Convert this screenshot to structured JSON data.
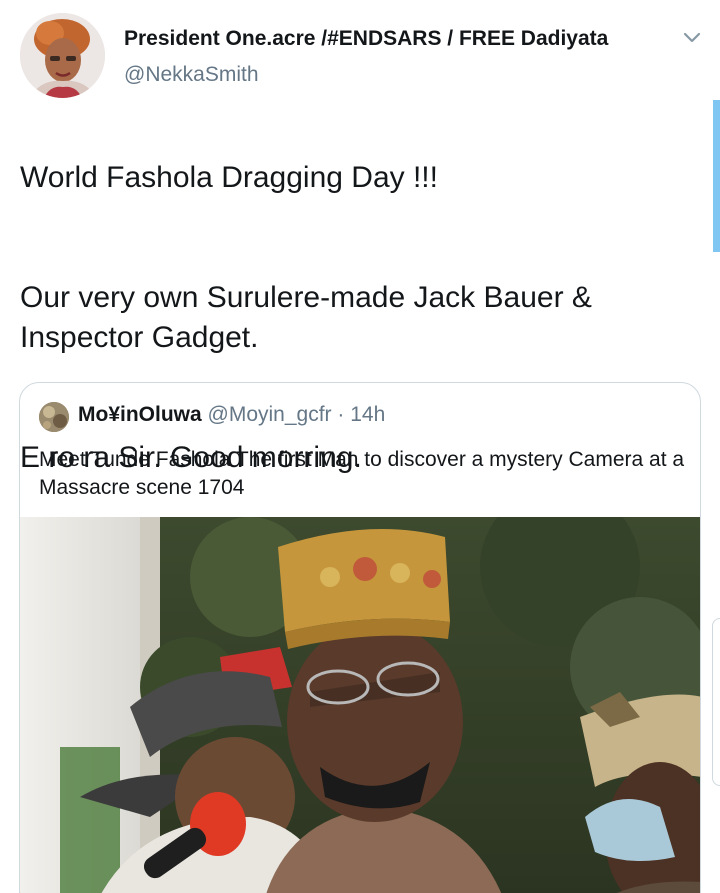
{
  "tweet": {
    "author_name": "President One.acre /#ENDSARS / FREE Dadiyata",
    "author_handle": "@NekkaSmith",
    "paragraphs": [
      "World Fashola Dragging Day !!!",
      "Our very own Surulere-made Jack Bauer &\nInspector Gadget.",
      "E ro ra Sir. Good morring."
    ],
    "menu_icon": "chevron-down-icon"
  },
  "quoted_tweet": {
    "author_name": "Mo¥inOluwa",
    "author_handle": "@Moyin_gcfr",
    "separator": "·",
    "time": "14h",
    "text": "Meet Tunde Fashola The first Man to discover a mystery Camera at a Massacre scene 1704"
  },
  "colors": {
    "text": "#14171a",
    "secondary": "#657786",
    "border": "#cfd9de",
    "accent": "#7fc6f2"
  }
}
